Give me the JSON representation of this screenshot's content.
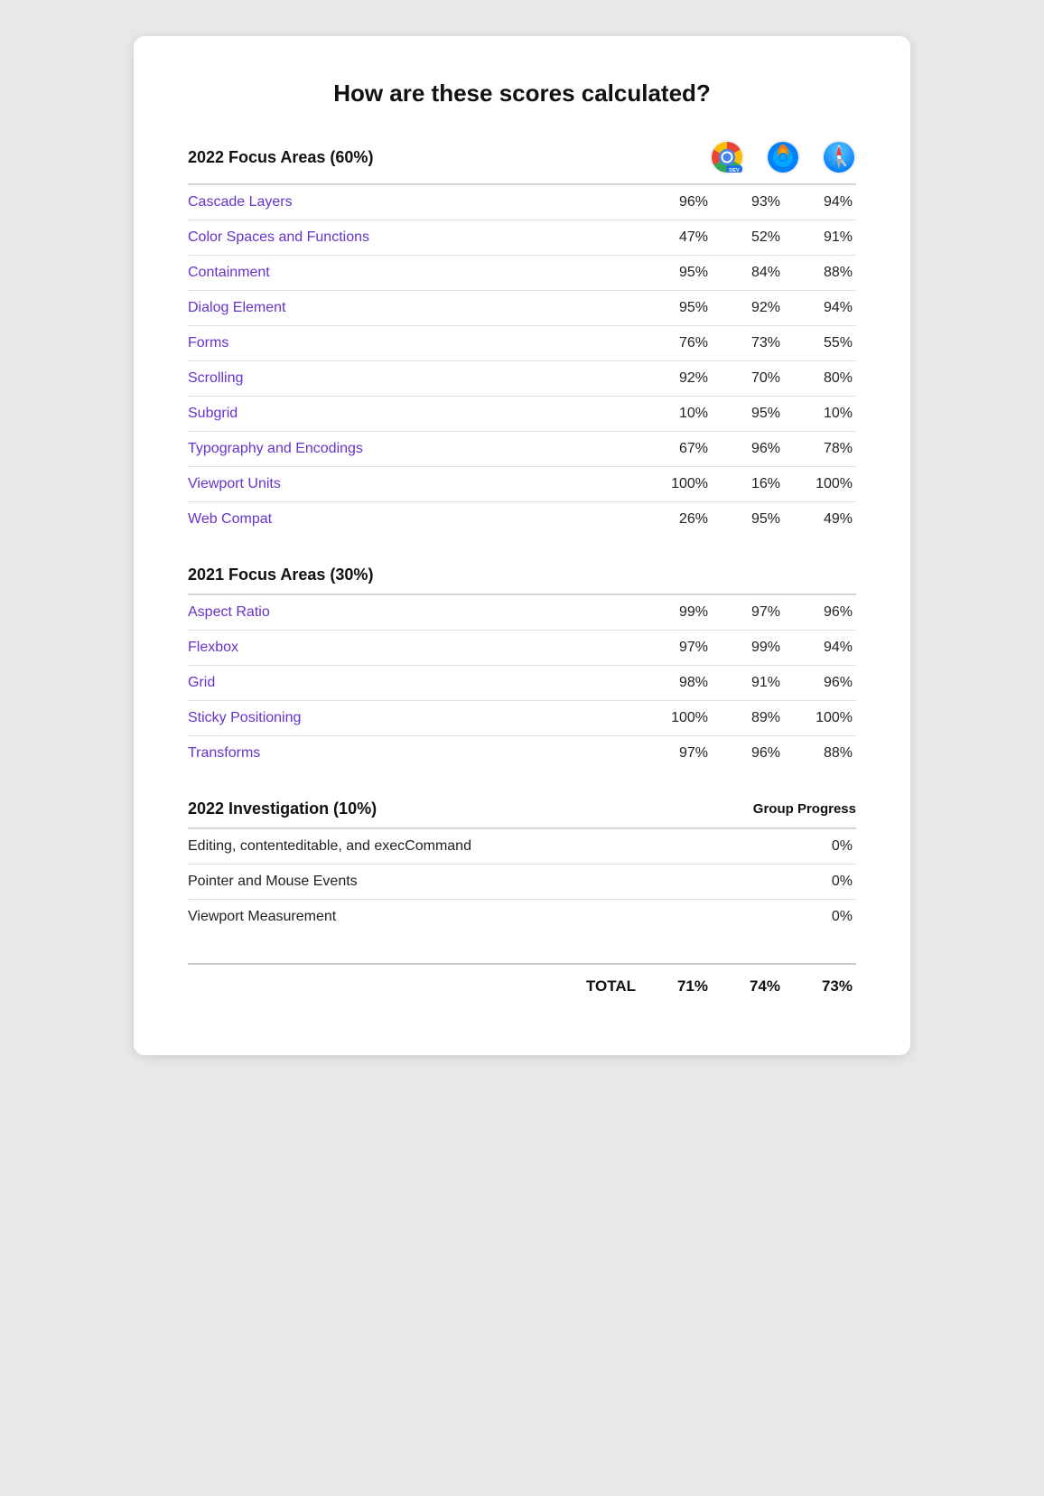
{
  "title": "How are these scores calculated?",
  "focus2022": {
    "heading": "2022 Focus Areas (60%)",
    "rows": [
      {
        "label": "Cascade Layers",
        "v1": "96%",
        "v2": "93%",
        "v3": "94%"
      },
      {
        "label": "Color Spaces and Functions",
        "v1": "47%",
        "v2": "52%",
        "v3": "91%"
      },
      {
        "label": "Containment",
        "v1": "95%",
        "v2": "84%",
        "v3": "88%"
      },
      {
        "label": "Dialog Element",
        "v1": "95%",
        "v2": "92%",
        "v3": "94%"
      },
      {
        "label": "Forms",
        "v1": "76%",
        "v2": "73%",
        "v3": "55%"
      },
      {
        "label": "Scrolling",
        "v1": "92%",
        "v2": "70%",
        "v3": "80%"
      },
      {
        "label": "Subgrid",
        "v1": "10%",
        "v2": "95%",
        "v3": "10%"
      },
      {
        "label": "Typography and Encodings",
        "v1": "67%",
        "v2": "96%",
        "v3": "78%"
      },
      {
        "label": "Viewport Units",
        "v1": "100%",
        "v2": "16%",
        "v3": "100%"
      },
      {
        "label": "Web Compat",
        "v1": "26%",
        "v2": "95%",
        "v3": "49%"
      }
    ]
  },
  "focus2021": {
    "heading": "2021 Focus Areas (30%)",
    "rows": [
      {
        "label": "Aspect Ratio",
        "v1": "99%",
        "v2": "97%",
        "v3": "96%"
      },
      {
        "label": "Flexbox",
        "v1": "97%",
        "v2": "99%",
        "v3": "94%"
      },
      {
        "label": "Grid",
        "v1": "98%",
        "v2": "91%",
        "v3": "96%"
      },
      {
        "label": "Sticky Positioning",
        "v1": "100%",
        "v2": "89%",
        "v3": "100%"
      },
      {
        "label": "Transforms",
        "v1": "97%",
        "v2": "96%",
        "v3": "88%"
      }
    ]
  },
  "investigation2022": {
    "heading": "2022 Investigation (10%)",
    "groupProgressLabel": "Group Progress",
    "rows": [
      {
        "label": "Editing, contenteditable, and execCommand",
        "v": "0%"
      },
      {
        "label": "Pointer and Mouse Events",
        "v": "0%"
      },
      {
        "label": "Viewport Measurement",
        "v": "0%"
      }
    ]
  },
  "totals": {
    "label": "TOTAL",
    "v1": "71%",
    "v2": "74%",
    "v3": "73%"
  }
}
